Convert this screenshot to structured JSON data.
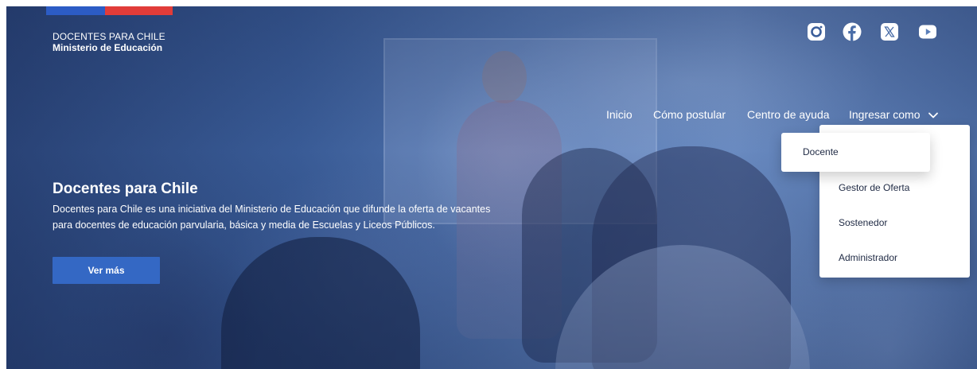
{
  "brand": {
    "line1": "DOCENTES PARA CHILE",
    "line2": "Ministerio de Educación",
    "flag_colors": [
      "#2c5cc5",
      "#e13c39"
    ]
  },
  "social": [
    {
      "icon": "instagram-icon"
    },
    {
      "icon": "facebook-icon"
    },
    {
      "icon": "x-twitter-icon"
    },
    {
      "icon": "youtube-icon"
    }
  ],
  "nav": {
    "items": [
      "Inicio",
      "Cómo postular",
      "Centro de ayuda"
    ],
    "login_label": "Ingresar como"
  },
  "dropdown": {
    "items": [
      "Docente",
      "Gestor de Oferta",
      "Sostenedor",
      "Administrador"
    ]
  },
  "hero": {
    "title": "Docentes para Chile",
    "description": "Docentes para Chile es una iniciativa del Ministerio de Educación que difunde la oferta de vacantes para docentes de educación parvularia, básica y media de Escuelas y Liceos Públicos.",
    "cta_label": "Ver más"
  },
  "colors": {
    "accent": "#3468c4",
    "overlay": "#2a4478"
  }
}
